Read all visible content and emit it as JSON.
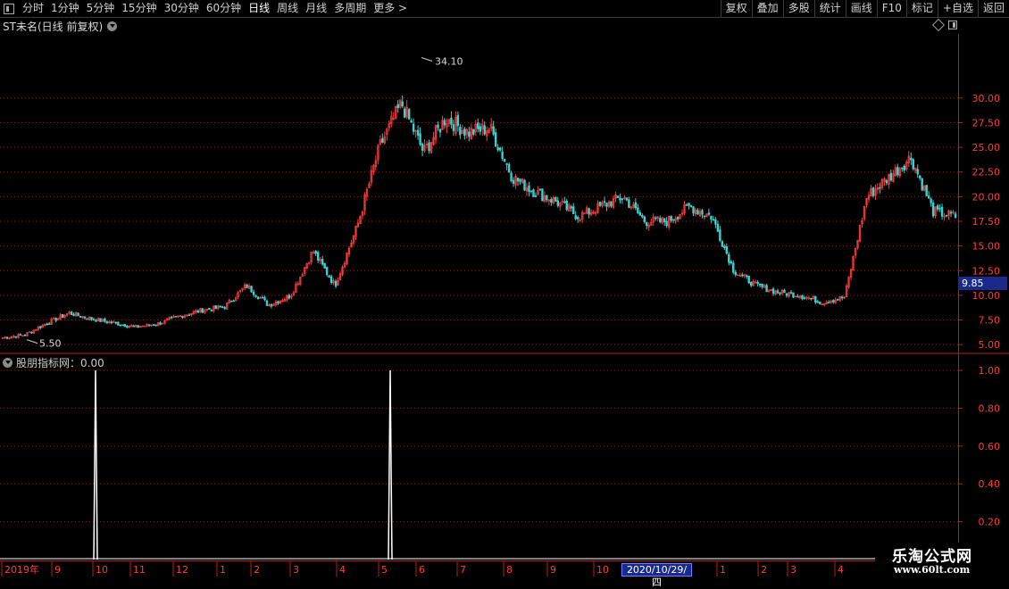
{
  "toolbar": {
    "periods": [
      "分时",
      "1分钟",
      "5分钟",
      "15分钟",
      "30分钟",
      "60分钟",
      "日线",
      "周线",
      "月线",
      "多周期",
      "更多 >"
    ],
    "active_period": "日线",
    "right_buttons": [
      "复权",
      "叠加",
      "多股",
      "统计",
      "画线",
      "F10",
      "标记",
      "+自选",
      "返回"
    ]
  },
  "chart_title": "ST未名(日线 前复权)",
  "indicator_title": "股朋指标网：0.00",
  "price_annotations": {
    "high_label": "34.10",
    "low_label": "5.50",
    "current_price": "9.85"
  },
  "x_axis": {
    "labels": [
      "2019年",
      "9",
      "10",
      "11",
      "12",
      "1",
      "2",
      "3",
      "4",
      "5",
      "6",
      "7",
      "8",
      "9",
      "10",
      "2020/10/29/四",
      "1",
      "2",
      "3",
      "4"
    ],
    "highlight": "2020/10/29/四"
  },
  "watermark": {
    "line1": "乐淘公式网",
    "line2": "www.60lt.com"
  },
  "colors": {
    "up": "#ff3c3c",
    "down": "#3cd2d2",
    "grid": "#8a1a1a",
    "axis": "#c01a1a",
    "signal": "#ffffff",
    "price_tag": "#1b2a8a"
  },
  "chart_data": [
    {
      "type": "candlestick",
      "title": "ST未名(日线 前复权)",
      "y_ticks": [
        5.0,
        7.5,
        10.0,
        12.5,
        15.0,
        17.5,
        20.0,
        22.5,
        25.0,
        27.5,
        30.0
      ],
      "ylim": [
        4.2,
        36.5
      ],
      "grid": true,
      "annotations": {
        "max": 34.1,
        "min": 5.5,
        "last": 9.85
      },
      "series": [
        {
          "name": "close",
          "values": [
            5.7,
            6.0,
            7.2,
            8.2,
            7.6,
            7.2,
            6.8,
            7.1,
            7.9,
            8.5,
            8.8,
            11.0,
            9.0,
            10.0,
            14.5,
            11.0,
            17.0,
            25.0,
            29.5,
            24.5,
            28.0,
            26.5,
            27.0,
            22.0,
            20.5,
            19.5,
            18.0,
            19.0,
            20.0,
            17.5,
            17.5,
            19.0,
            18.0,
            12.5,
            11.0,
            10.3,
            10.0,
            9.3,
            9.8,
            20.0,
            22.0,
            24.0,
            18.5,
            18.0
          ]
        }
      ]
    },
    {
      "type": "line",
      "title": "股朋指标网",
      "y_ticks": [
        0.2,
        0.4,
        0.6,
        0.8,
        1.0
      ],
      "ylim": [
        0.0,
        1.08
      ],
      "signals": [
        {
          "x_label": "10",
          "value": 1.0
        },
        {
          "x_label": "5",
          "value": 1.0
        }
      ],
      "value_shown": 0.0
    }
  ]
}
